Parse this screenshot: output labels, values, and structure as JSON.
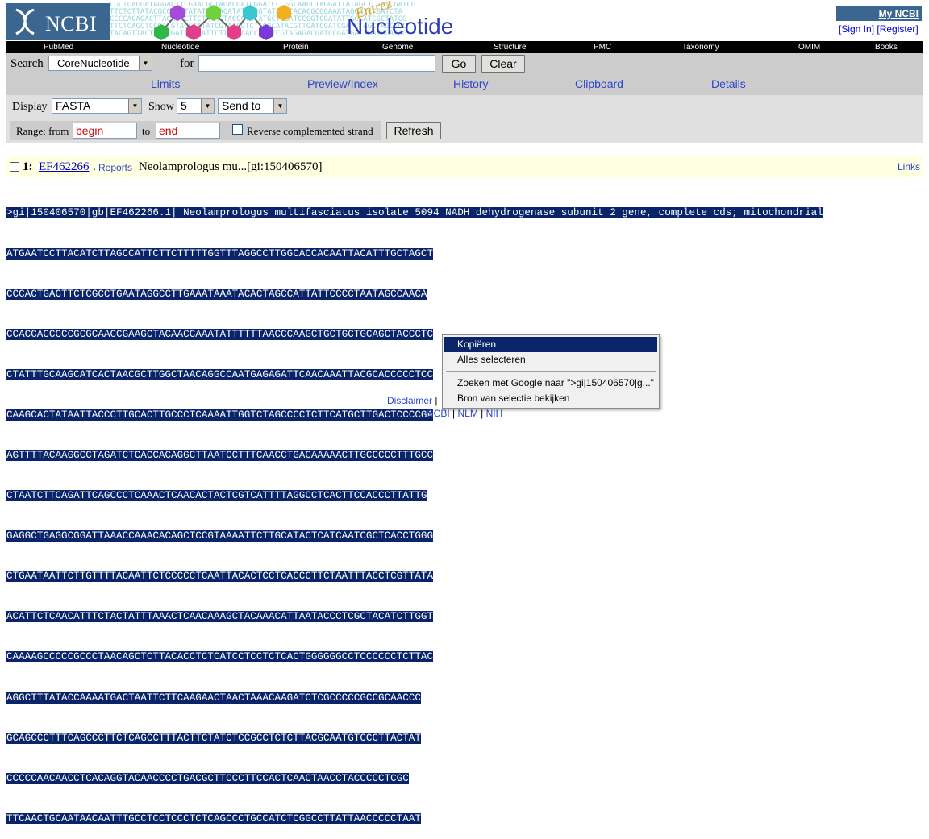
{
  "header": {
    "logo_text": "NCBI",
    "entrez_text": "Entrez",
    "db_title": "Nucleotide",
    "myncbi": "My NCBI",
    "sign_in": "[Sign In]",
    "register": "[Register]"
  },
  "db_nav": [
    "PubMed",
    "Nucleotide",
    "Protein",
    "Genome",
    "Structure",
    "PMC",
    "Taxonomy",
    "OMIM",
    "Books"
  ],
  "search": {
    "label": "Search",
    "db_selected": "CoreNucleotide",
    "for_label": "for",
    "term_value": "",
    "go": "Go",
    "clear": "Clear"
  },
  "features": [
    "Limits",
    "Preview/Index",
    "History",
    "Clipboard",
    "Details"
  ],
  "display": {
    "label": "Display",
    "format": "FASTA",
    "show_label": "Show",
    "show_count": "5",
    "send_to": "Send to",
    "range_label": "Range: from",
    "from_value": "begin",
    "to_label": "to",
    "to_value": "end",
    "reverse_label": "Reverse complemented strand",
    "refresh": "Refresh"
  },
  "record": {
    "number": "1:",
    "accession": "EF462266",
    "dot": ".",
    "reports": "Reports",
    "title": "Neolamprologus mu...[gi:150406570]",
    "links": "Links",
    "fasta_lines": [
      ">gi|150406570|gb|EF462266.1| Neolamprologus multifasciatus isolate 5094 NADH dehydrogenase subunit 2 gene, complete cds; mitochondrial",
      "ATGAATCCTTACATCTTAGCCATTCTTCTTTTTGGTTTAGGCCTTGGCACCACAATTACATTTGCTAGCT",
      "CCCACTGACTTCTCGCCTGAATAGGCCTTGAAATAAATACACTAGCCATTATTCCCCTAATAGCCAACA",
      "CCACCACCCCCGCGCAACCGAAGCTACAACCAAATATTTTTTAACCCAAGCTGCTGCTGCAGCTACCCTC",
      "CTATTTGCAAGCATCACTAACGCTTGGCTAACAGGCCAATGAGAGATTCAACAAATTACGCACCCCCTCC",
      "CAAGCACTATAATTACCCTTGCACTTGCCCTCAAAATTGGTCTAGCCCCTCTTCATGCTTGACTCCCCGA",
      "AGTTTTACAAGGCCTAGATCTCACCACAGGCTTAATCCTTTCAACCTGACAAAAACTTGCCCCCTTTGCC",
      "CTAATCTTCAGATTCAGCCCTCAAACTCAACACTACTCGTCATTTTAGGCCTCACTTCCACCCTTATTG",
      "GAGGCTGAGGCGGATTAAACCAAACACAGCTCCGTAAAATTCTTGCATACTCATCAATCGCTCACCTGGG",
      "CTGAATAATTCTTGTTTTACAATTCTCCCCCTCAATTACACTCCTCACCCTTCTAATTTACCTCGTTATA",
      "ACATTCTCAACATTTCTACTATTTAAACTCAACAAAGCTACAAACATTAATACCCTCGCTACATCTTGGT",
      "CAAAAGCCCCCGCCCTAACAGCTCTTACACCTCTCATCCTCCTCTCACTGGGGGGCCTCCCCCCTCTTAC",
      "AGGCTTTATACCAAAATGACTAATTCTTCAAGAACTAACTAAACAAGATCTCGCCCCCGCCGCAACCC",
      "GCAGCCCTTTCAGCCCTTCTCAGCCTTTACTTCTATCTCCGCCTCTCTTACGCAATGTCCCTTACTAT",
      "CCCCCAACAACCTCACAGGTACAACCCCTGACGCTTCCCTTCCACTCAACTAACCTACCCCCTCGC",
      "TTCAACTGCAATAACAATTTGCCTCCTCCCTCTCAGCCCTGCCATCTCGGCCTTATTAACCCCCTAAT"
    ]
  },
  "footer": {
    "disclaimer": "Disclaimer",
    "sep": "|",
    "ncbi": "NCBI",
    "nlm": "NLM",
    "nih": "NIH"
  },
  "context_menu": {
    "items": [
      "Kopiëren",
      "Alles selecteren",
      "Zoeken met Google naar \">gi|150406570|g...\"",
      "Bron van selectie bekijken"
    ],
    "highlighted_index": 0
  },
  "colors": {
    "ncbi_blue": "#3a6690",
    "selection": "#0a246a",
    "link": "#2b45c8",
    "record_bg": "#ffffe2"
  }
}
